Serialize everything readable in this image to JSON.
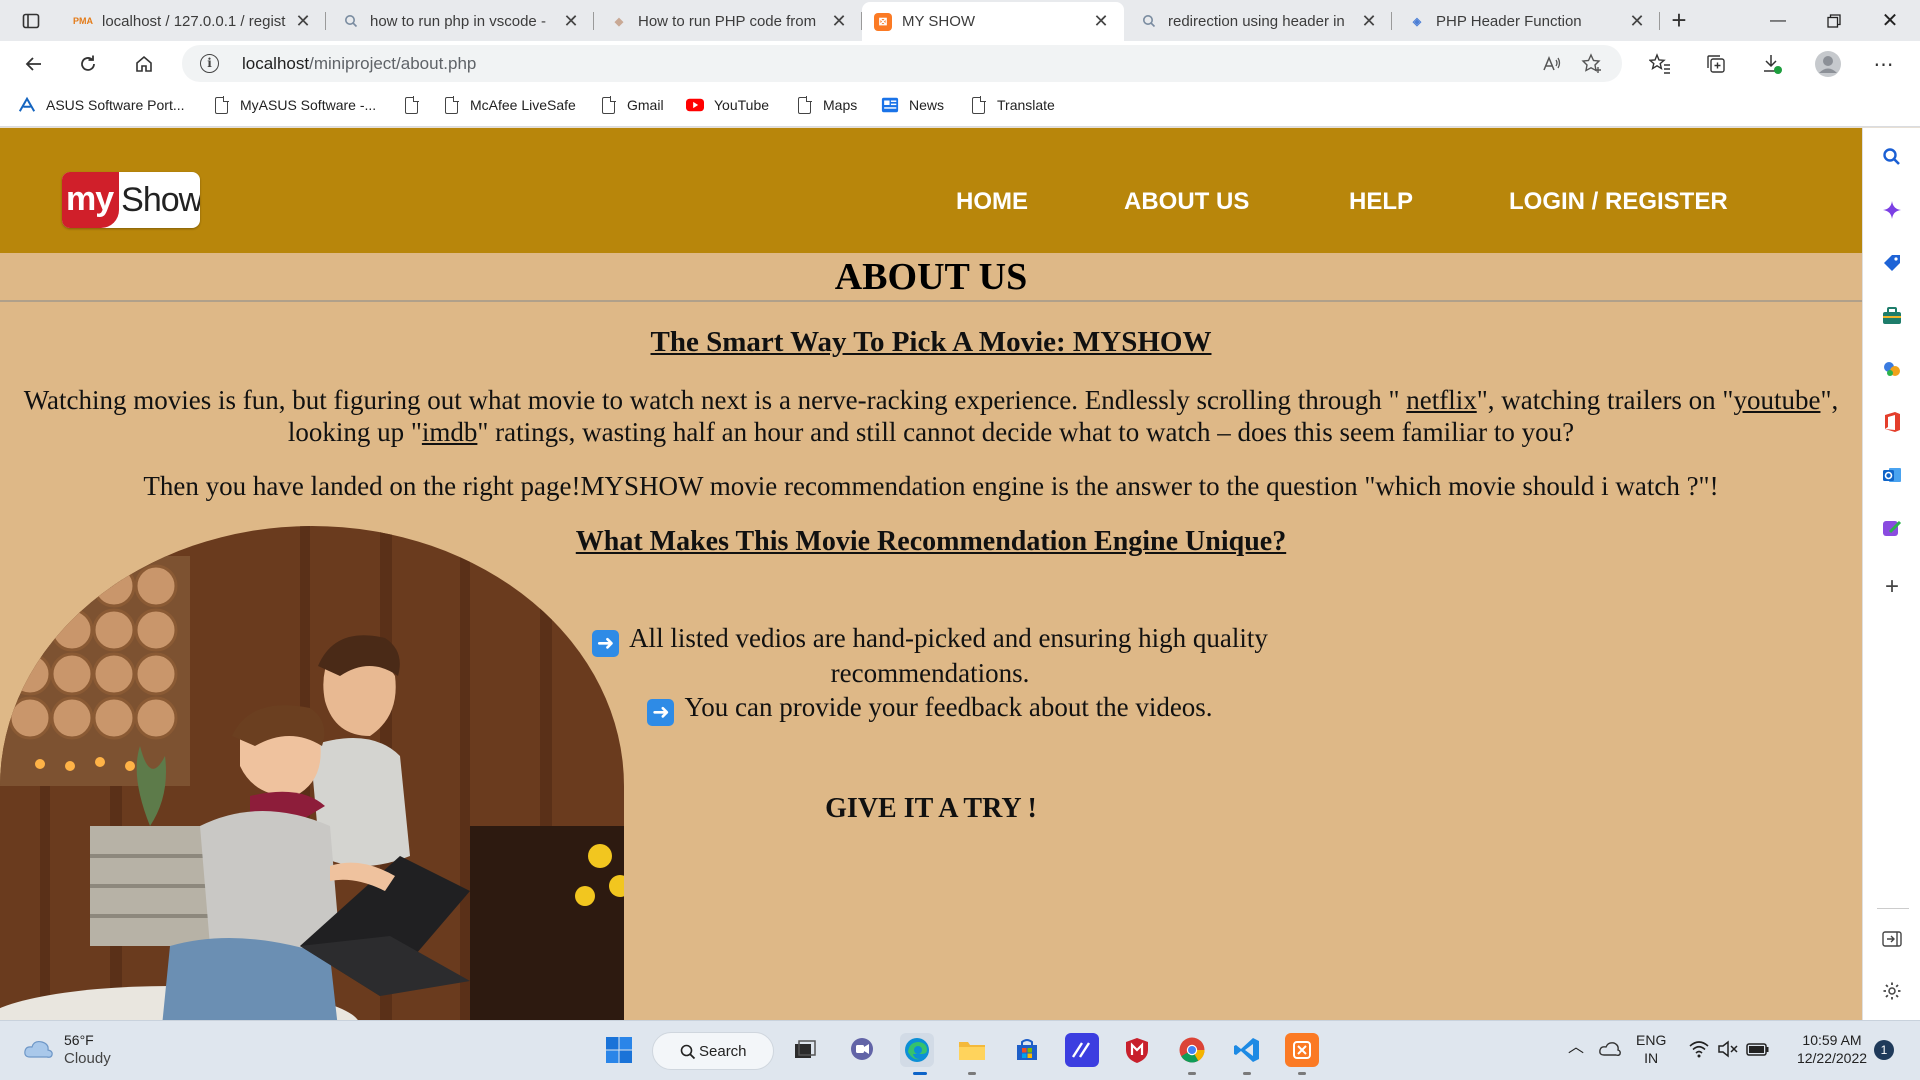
{
  "browser": {
    "tabs": [
      {
        "title": "localhost / 127.0.0.1 / regist",
        "favicon": "phpmyadmin-icon"
      },
      {
        "title": "how to run php in vscode -",
        "favicon": "search-icon"
      },
      {
        "title": "How to run PHP code from",
        "favicon": "bookmark-icon"
      },
      {
        "title": "MY SHOW",
        "favicon": "xampp-icon",
        "active": true
      },
      {
        "title": "redirection using header in",
        "favicon": "search-icon"
      },
      {
        "title": "PHP Header Function",
        "favicon": "diamond-icon"
      }
    ],
    "address": {
      "host": "localhost",
      "path": "/miniproject/about.php"
    },
    "favorites": [
      {
        "label": "ASUS Software Port...",
        "icon": "asus-icon"
      },
      {
        "label": "MyASUS Software -...",
        "icon": "page-icon"
      },
      {
        "label": "",
        "icon": "page-icon"
      },
      {
        "label": "McAfee LiveSafe",
        "icon": "page-icon"
      },
      {
        "label": "Gmail",
        "icon": "page-icon"
      },
      {
        "label": "YouTube",
        "icon": "youtube-icon"
      },
      {
        "label": "Maps",
        "icon": "page-icon"
      },
      {
        "label": "News",
        "icon": "news-icon"
      },
      {
        "label": "Translate",
        "icon": "page-icon"
      }
    ]
  },
  "site": {
    "logo": {
      "part1": "my",
      "part2": "Show"
    },
    "nav": [
      "HOME",
      "ABOUT US",
      "HELP",
      "LOGIN / REGISTER"
    ],
    "page_title": "ABOUT US",
    "heading1": "The Smart Way To Pick A Movie: MYSHOW",
    "intro": {
      "t1": "Watching movies is fun, but figuring out what movie to watch next is a nerve-racking experience. Endlessly scrolling through \" ",
      "link1": "netflix",
      "t2": "\", watching trailers on \"",
      "link2": "youtube",
      "t3": "\", looking up \"",
      "link3": "imdb",
      "t4": "\" ratings, wasting half an hour and still cannot decide what to watch – does this seem familiar to you?"
    },
    "paragraph2": "Then you have landed on the right page!MYSHOW movie recommendation engine is the answer to the question \"which movie should i watch ?\"!",
    "heading2": "What Makes This Movie Recommendation Engine Unique?",
    "features": [
      "All listed vedios are hand-picked and ensuring high quality recommendations.",
      "You can provide your feedback about the videos."
    ],
    "cta": "GIVE IT A TRY !"
  },
  "taskbar": {
    "weather": {
      "temp": "56°F",
      "condition": "Cloudy"
    },
    "search_label": "Search",
    "lang": {
      "line1": "ENG",
      "line2": "IN"
    },
    "clock": {
      "time": "10:59 AM",
      "date": "12/22/2022"
    },
    "notifications": "1"
  },
  "colors": {
    "header": "#b8860b",
    "page_bg": "#deb887"
  }
}
